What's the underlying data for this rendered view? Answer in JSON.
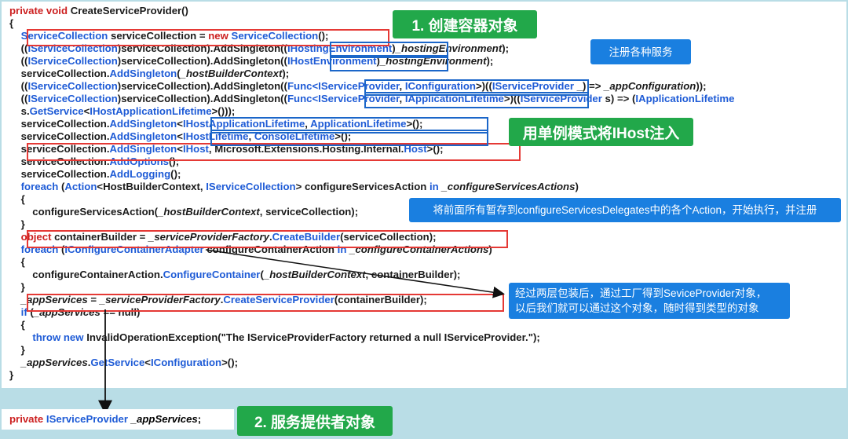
{
  "code_lines": [
    [
      {
        "t": "private void ",
        "c": "kw"
      },
      {
        "t": "CreateServiceProvider()"
      }
    ],
    [
      {
        "t": "{"
      }
    ],
    [
      {
        "t": "    "
      },
      {
        "t": "ServiceCollection",
        "c": "ty"
      },
      {
        "t": " serviceCollection = "
      },
      {
        "t": "new ",
        "c": "kw"
      },
      {
        "t": "ServiceCollection",
        "c": "ty"
      },
      {
        "t": "();"
      }
    ],
    [
      {
        "t": "    (("
      },
      {
        "t": "IServiceCollection",
        "c": "ty"
      },
      {
        "t": ")serviceCollection).AddSingleton(("
      },
      {
        "t": "IHostingEnvironment",
        "c": "ty"
      },
      {
        "t": ")"
      },
      {
        "t": "_hostingEnvironment",
        "c": "it"
      },
      {
        "t": ");"
      }
    ],
    [
      {
        "t": "    (("
      },
      {
        "t": "IServiceCollection",
        "c": "ty"
      },
      {
        "t": ")serviceCollection).AddSingleton(("
      },
      {
        "t": "IHostEnvironment",
        "c": "ty"
      },
      {
        "t": ")"
      },
      {
        "t": "_hostingEnvironment",
        "c": "it"
      },
      {
        "t": ");"
      }
    ],
    [
      {
        "t": "    serviceCollection."
      },
      {
        "t": "AddSingleton",
        "c": "ty"
      },
      {
        "t": "("
      },
      {
        "t": "_hostBuilderContext",
        "c": "it"
      },
      {
        "t": ");"
      }
    ],
    [
      {
        "t": "    (("
      },
      {
        "t": "IServiceCollection",
        "c": "ty"
      },
      {
        "t": ")serviceCollection).AddSingleton(("
      },
      {
        "t": "Func<IServiceProvider",
        "c": "ty"
      },
      {
        "t": ", "
      },
      {
        "t": "IConfiguration",
        "c": "ty"
      },
      {
        "t": ">)(("
      },
      {
        "t": "IServiceProvider",
        "c": "ty"
      },
      {
        "t": " _) => "
      },
      {
        "t": "_appConfiguration",
        "c": "it"
      },
      {
        "t": "));"
      }
    ],
    [
      {
        "t": "    (("
      },
      {
        "t": "IServiceCollection",
        "c": "ty"
      },
      {
        "t": ")serviceCollection).AddSingleton(("
      },
      {
        "t": "Func<IServiceProvider",
        "c": "ty"
      },
      {
        "t": ", "
      },
      {
        "t": "IApplicationLifetime",
        "c": "ty"
      },
      {
        "t": ">)(("
      },
      {
        "t": "IServiceProvider",
        "c": "ty"
      },
      {
        "t": " s) => ("
      },
      {
        "t": "IApplicationLifetime",
        "c": "ty"
      }
    ],
    [
      {
        "t": "    s."
      },
      {
        "t": "GetService",
        "c": "ty"
      },
      {
        "t": "<"
      },
      {
        "t": "IHostApplicationLifetime",
        "c": "ty"
      },
      {
        "t": ">()));"
      }
    ],
    [
      {
        "t": "    serviceCollection."
      },
      {
        "t": "AddSingleton",
        "c": "ty"
      },
      {
        "t": "<"
      },
      {
        "t": "IHostApplicationLifetime",
        "c": "ty"
      },
      {
        "t": ", "
      },
      {
        "t": "ApplicationLifetime",
        "c": "ty"
      },
      {
        "t": ">();"
      }
    ],
    [
      {
        "t": "    serviceCollection."
      },
      {
        "t": "AddSingleton",
        "c": "ty"
      },
      {
        "t": "<"
      },
      {
        "t": "IHostLifetime",
        "c": "ty"
      },
      {
        "t": ", "
      },
      {
        "t": "ConsoleLifetime",
        "c": "ty"
      },
      {
        "t": ">();"
      }
    ],
    [
      {
        "t": "    serviceCollection."
      },
      {
        "t": "AddSingleton",
        "c": "ty"
      },
      {
        "t": "<"
      },
      {
        "t": "IHost",
        "c": "ty"
      },
      {
        "t": ", Microsoft.Extensions.Hosting.Internal."
      },
      {
        "t": "Host",
        "c": "ty"
      },
      {
        "t": ">();"
      }
    ],
    [
      {
        "t": "    serviceCollection."
      },
      {
        "t": "AddOptions",
        "c": "ty"
      },
      {
        "t": "();"
      }
    ],
    [
      {
        "t": "    serviceCollection."
      },
      {
        "t": "AddLogging",
        "c": "ty"
      },
      {
        "t": "();"
      }
    ],
    [
      {
        "t": "    "
      },
      {
        "t": "foreach",
        "c": "ty"
      },
      {
        "t": " ("
      },
      {
        "t": "Action",
        "c": "ty"
      },
      {
        "t": "<HostBuilderContext, "
      },
      {
        "t": "IServiceCollection",
        "c": "ty"
      },
      {
        "t": "> configureServicesAction "
      },
      {
        "t": "in",
        "c": "ty"
      },
      {
        "t": " "
      },
      {
        "t": "_configureServicesActions",
        "c": "it"
      },
      {
        "t": ")"
      }
    ],
    [
      {
        "t": "    {"
      }
    ],
    [
      {
        "t": "        configureServicesAction("
      },
      {
        "t": "_hostBuilderContext",
        "c": "it"
      },
      {
        "t": ", serviceCollection);"
      }
    ],
    [
      {
        "t": "    }"
      }
    ],
    [
      {
        "t": "    "
      },
      {
        "t": "object",
        "c": "kw"
      },
      {
        "t": " containerBuilder = "
      },
      {
        "t": "_serviceProviderFactory",
        "c": "it"
      },
      {
        "t": "."
      },
      {
        "t": "CreateBuilder",
        "c": "ty"
      },
      {
        "t": "(serviceCollection);"
      }
    ],
    [
      {
        "t": "    "
      },
      {
        "t": "foreach",
        "c": "ty"
      },
      {
        "t": " ("
      },
      {
        "t": "IConfigureContainerAdapter",
        "c": "ty"
      },
      {
        "t": " configureContainerAction "
      },
      {
        "t": "in",
        "c": "ty"
      },
      {
        "t": " "
      },
      {
        "t": "_configureContainerActions",
        "c": "it"
      },
      {
        "t": ")"
      }
    ],
    [
      {
        "t": "    {"
      }
    ],
    [
      {
        "t": "        configureContainerAction."
      },
      {
        "t": "ConfigureContainer",
        "c": "ty"
      },
      {
        "t": "("
      },
      {
        "t": "_hostBuilderContext",
        "c": "it"
      },
      {
        "t": ", containerBuilder);"
      }
    ],
    [
      {
        "t": "    }"
      }
    ],
    [
      {
        "t": "    "
      },
      {
        "t": "_appServices",
        "c": "it"
      },
      {
        "t": " = "
      },
      {
        "t": "_serviceProviderFactory",
        "c": "it"
      },
      {
        "t": "."
      },
      {
        "t": "CreateServiceProvider",
        "c": "ty"
      },
      {
        "t": "(containerBuilder);"
      }
    ],
    [
      {
        "t": "    "
      },
      {
        "t": "if",
        "c": "ty"
      },
      {
        "t": " ("
      },
      {
        "t": "_appServices",
        "c": "it"
      },
      {
        "t": " == null)"
      }
    ],
    [
      {
        "t": "    {"
      }
    ],
    [
      {
        "t": "        "
      },
      {
        "t": "throw new",
        "c": "ty"
      },
      {
        "t": " InvalidOperationException(\"The IServiceProviderFactory returned a null IServiceProvider.\");"
      }
    ],
    [
      {
        "t": "    }"
      }
    ],
    [
      {
        "t": "    "
      },
      {
        "t": "_appServices",
        "c": "it"
      },
      {
        "t": "."
      },
      {
        "t": "GetService",
        "c": "ty"
      },
      {
        "t": "<"
      },
      {
        "t": "IConfiguration",
        "c": "ty"
      },
      {
        "t": ">();"
      }
    ],
    [
      {
        "t": "}"
      }
    ]
  ],
  "bottom_code": [
    {
      "t": "private ",
      "c": "kw"
    },
    {
      "t": "IServiceProvider",
      "c": "ty"
    },
    {
      "t": " "
    },
    {
      "t": "_appServices",
      "c": "it"
    },
    {
      "t": ";"
    }
  ],
  "callouts": {
    "create_container": "1. 创建容器对象",
    "register_services": "注册各种服务",
    "singleton_ihost": "用单例模式将IHost注入",
    "execute_actions": "将前面所有暂存到configureServicesDelegates中的各个Action，开始执行，并注册",
    "factory_note_line1": "经过两层包装后，通过工厂得到SeviceProvider对象，",
    "factory_note_line2": "以后我们就可以通过这个对象，随时得到类型的对象",
    "service_provider_object": "2. 服务提供者对象"
  },
  "colors": {
    "keyword": "#cc1f1f",
    "type": "#1e5bd6",
    "green_callout": "#22a84a",
    "blue_callout": "#1a7fe0",
    "red_box": "#e53935",
    "blue_box": "#1b66c9",
    "background": "#b9dde6"
  }
}
